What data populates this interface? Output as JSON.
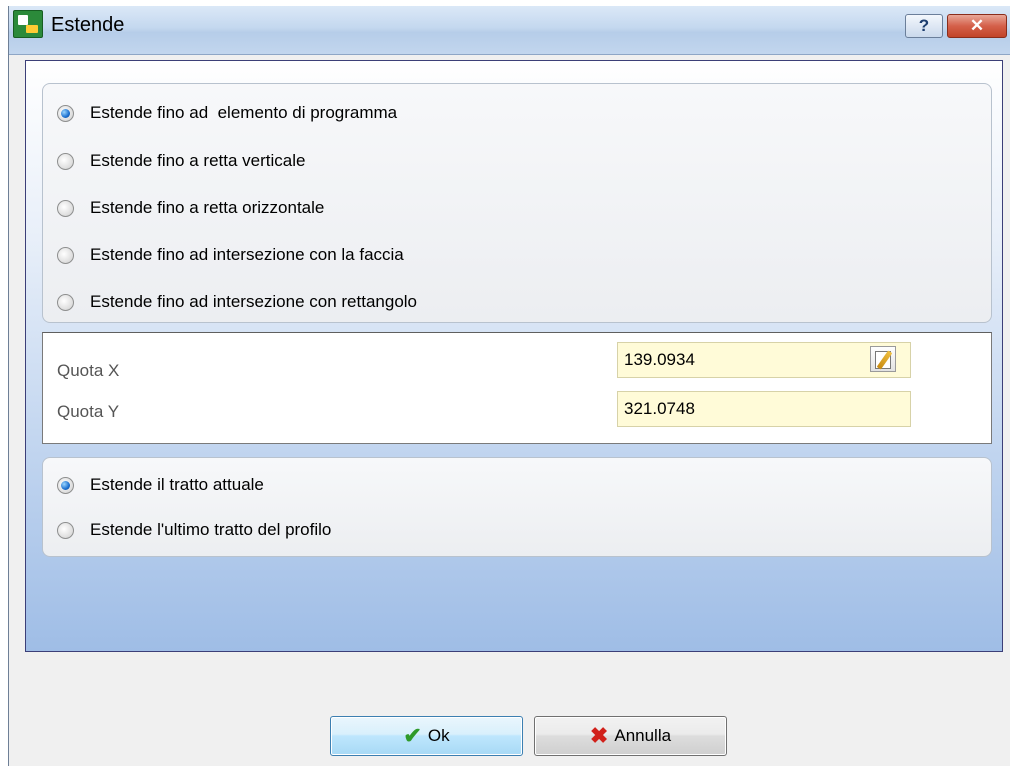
{
  "window": {
    "title": "Estende",
    "help_label": "?",
    "close_label": "✕"
  },
  "extend_options": [
    {
      "label": "Estende fino ad  elemento di programma",
      "checked": true
    },
    {
      "label": "Estende fino a retta verticale",
      "checked": false
    },
    {
      "label": "Estende fino a retta orizzontale",
      "checked": false
    },
    {
      "label": "Estende fino ad intersezione con la faccia",
      "checked": false
    },
    {
      "label": "Estende fino ad intersezione con rettangolo",
      "checked": false
    }
  ],
  "quote": {
    "x_label": "Quota X",
    "x_value": "139.0934",
    "y_label": "Quota Y",
    "y_value": "321.0748"
  },
  "segment_options": [
    {
      "label": "Estende il tratto attuale",
      "checked": true
    },
    {
      "label": "Estende l'ultimo tratto del profilo",
      "checked": false
    }
  ],
  "buttons": {
    "ok_label": "Ok",
    "cancel_label": "Annulla"
  },
  "icons": {
    "app": "app-icon",
    "edit": "edit-icon",
    "ok": "check-icon",
    "cancel": "x-icon"
  }
}
